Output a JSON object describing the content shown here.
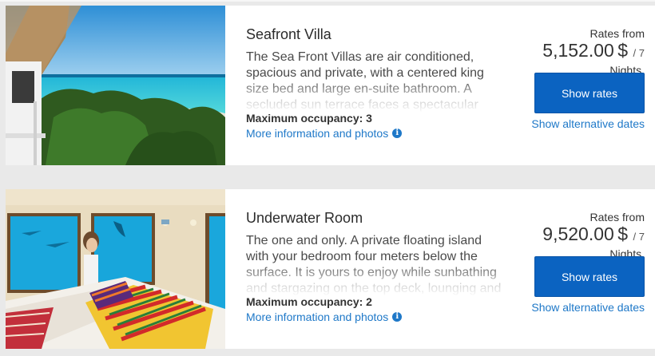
{
  "rooms": [
    {
      "title": "Seafront Villa",
      "description": "The Sea Front Villas are air conditioned, spacious and private, with a centered king size bed and large en-suite bathroom. A secluded sun terrace faces a spectacular ocean view, steps away from the beach.",
      "occupancy": "Maximum occupancy: 3",
      "more_info": "More information and photos",
      "rates_from": "Rates from",
      "amount": "5,152.00",
      "currency": "$",
      "per": "/ 7",
      "nights": "Nights.",
      "show_rates": "Show rates",
      "alt_dates": "Show alternative dates",
      "photo_icon": "beach-villa-photo"
    },
    {
      "title": "Underwater Room",
      "description": "The one and only. A private floating island with your bedroom four meters below the surface. It is yours to enjoy while sunbathing and stargazing on the top deck, lounging and watching the sea life in the room below.",
      "occupancy": "Maximum occupancy: 2",
      "more_info": "More information and photos",
      "rates_from": "Rates from",
      "amount": "9,520.00",
      "currency": "$",
      "per": "/ 7",
      "nights": "Nights.",
      "show_rates": "Show rates",
      "alt_dates": "Show alternative dates",
      "photo_icon": "underwater-room-photo"
    }
  ],
  "colors": {
    "accent": "#0b63c1",
    "link": "#1e78c8",
    "background": "#e9e9e9"
  }
}
